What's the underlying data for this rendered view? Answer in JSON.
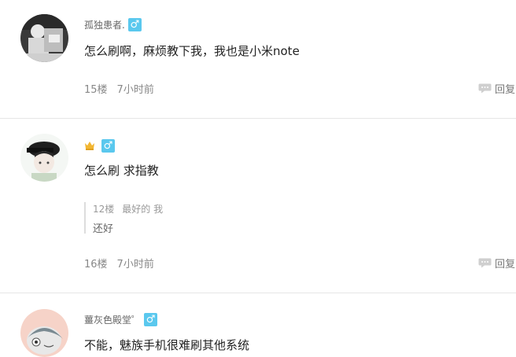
{
  "posts": [
    {
      "username": "孤独患者.",
      "gender": "♂",
      "content": "怎么刷啊，麻烦教下我，我也是小米note",
      "floor": "15楼",
      "time": "7小时前",
      "reply_label": "回复"
    },
    {
      "username": "",
      "gender": "♂",
      "content": "怎么刷 求指教",
      "quote": {
        "floor": "12楼",
        "author": "最好的 我",
        "text": "还好"
      },
      "floor": "16楼",
      "time": "7小时前",
      "reply_label": "回复"
    },
    {
      "username": "薑灰色殿堂゜",
      "gender": "♂",
      "content": "不能，魅族手机很难刷其他系统"
    }
  ],
  "colors": {
    "gender_badge": "#5ac8ee",
    "divider": "#e6e6e6"
  }
}
